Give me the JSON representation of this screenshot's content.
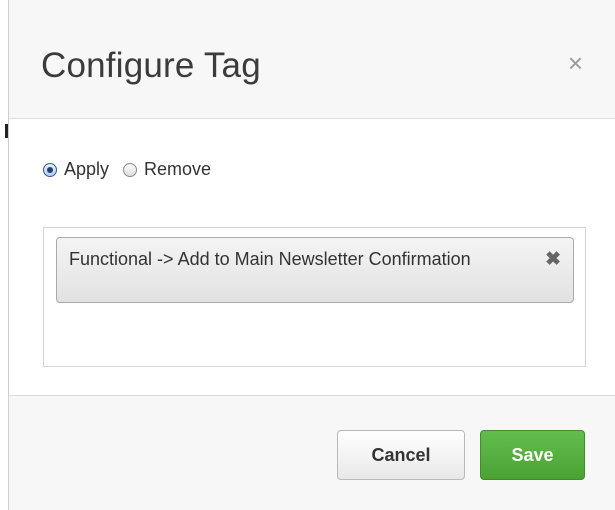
{
  "dialog": {
    "title": "Configure Tag",
    "close_glyph": "×"
  },
  "mode": {
    "options": [
      {
        "label": "Apply",
        "checked": true
      },
      {
        "label": "Remove",
        "checked": false
      }
    ]
  },
  "tags": [
    {
      "label": "Functional -> Add to Main Newsletter Confirmation",
      "remove_glyph": "✖"
    }
  ],
  "footer": {
    "cancel_label": "Cancel",
    "save_label": "Save"
  },
  "colors": {
    "save": "#56ae3e",
    "selected_radio": "#1e3f78"
  }
}
